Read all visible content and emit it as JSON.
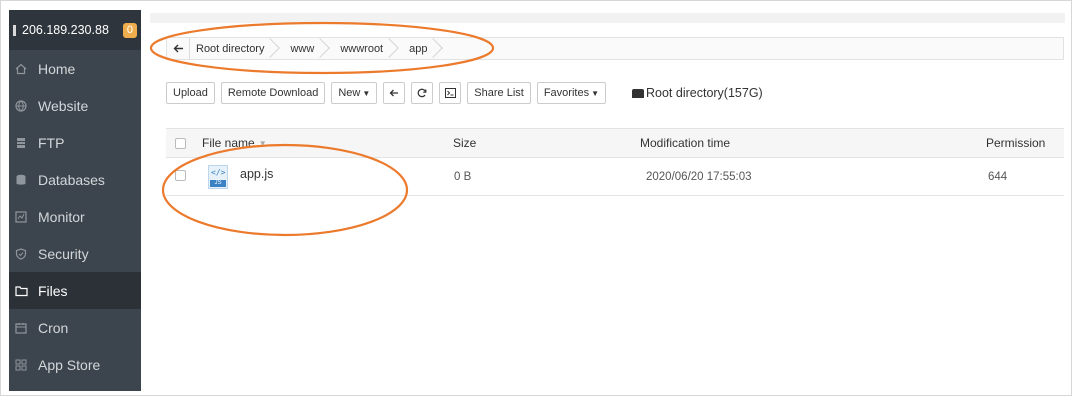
{
  "sidebar": {
    "server_ip": "206.189.230.88",
    "badge_count": "0",
    "items": [
      {
        "label": "Home",
        "icon": "home-icon"
      },
      {
        "label": "Website",
        "icon": "globe-icon"
      },
      {
        "label": "FTP",
        "icon": "ftp-icon"
      },
      {
        "label": "Databases",
        "icon": "database-icon"
      },
      {
        "label": "Monitor",
        "icon": "monitor-icon"
      },
      {
        "label": "Security",
        "icon": "shield-icon"
      },
      {
        "label": "Files",
        "icon": "folder-icon",
        "active": true
      },
      {
        "label": "Cron",
        "icon": "calendar-icon"
      },
      {
        "label": "App Store",
        "icon": "grid-icon"
      }
    ]
  },
  "breadcrumb": {
    "back_icon": "arrow-left-icon",
    "items": [
      "Root directory",
      "www",
      "wwwroot",
      "app"
    ]
  },
  "toolbar": {
    "upload": "Upload",
    "remote_download": "Remote Download",
    "new": "New",
    "share_list": "Share List",
    "favorites": "Favorites",
    "disk_label": "Root directory(157G)"
  },
  "table": {
    "headers": {
      "name": "File name",
      "size": "Size",
      "modified": "Modification time",
      "permission": "Permission"
    },
    "rows": [
      {
        "name": "app.js",
        "size": "0 B",
        "modified": "2020/06/20 17:55:03",
        "permission": "644",
        "icon": "js-file-icon",
        "icon_tag": "</>",
        "icon_label": "JS"
      }
    ]
  },
  "colors": {
    "sidebar_bg": "#3c444d",
    "sidebar_active": "#2b3137",
    "badge": "#f0ad4e",
    "annotation": "#ec7a2c"
  }
}
